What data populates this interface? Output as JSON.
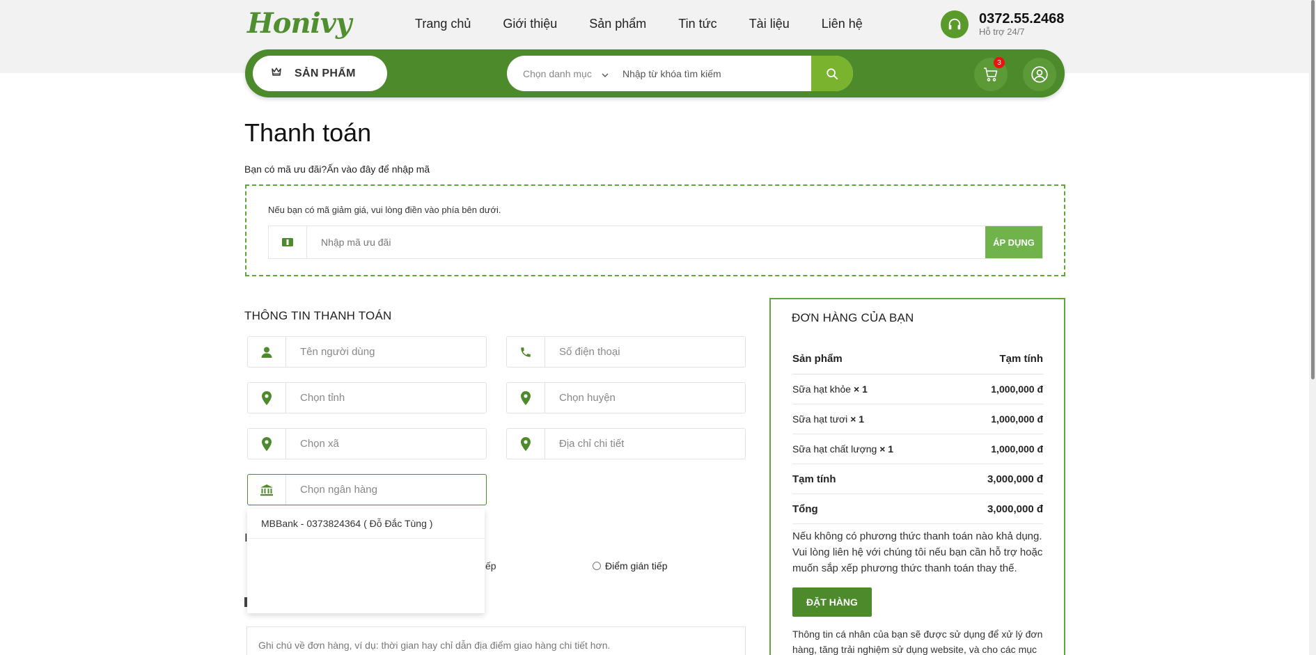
{
  "brand": {
    "logo_text": "Honivy"
  },
  "nav": {
    "items": [
      {
        "label": "Trang chủ"
      },
      {
        "label": "Giới thiệu"
      },
      {
        "label": "Sản phẩm"
      },
      {
        "label": "Tin tức"
      },
      {
        "label": "Tài liệu"
      },
      {
        "label": "Liên hệ"
      }
    ]
  },
  "hotline": {
    "number": "0372.55.2468",
    "sub": "Hỗ trợ 24/7",
    "icon": "headset-icon"
  },
  "toolbar": {
    "products_label": "SẢN PHẨM",
    "category_placeholder": "Chọn danh mục",
    "search_placeholder": "Nhập từ khóa tìm kiếm",
    "cart_count": "3"
  },
  "page": {
    "title": "Thanh toán",
    "coupon_prompt": "Bạn có mã ưu đãi?Ấn vào đây để nhập mã",
    "coupon_note": "Nếu bạn có mã giảm giá, vui lòng điền vào phía bên dưới.",
    "coupon_placeholder": "Nhập mã ưu đãi",
    "apply_label": "ÁP DỤNG"
  },
  "billing": {
    "title": "THÔNG TIN THANH TOÁN",
    "fields": {
      "name": "Tên người dùng",
      "phone": "Số điện thoại",
      "province": "Chọn tỉnh",
      "district": "Chọn huyện",
      "ward": "Chọn xã",
      "address": "Địa chỉ chi tiết",
      "bank": "Chọn ngân hàng"
    },
    "bank_options": [
      "MBBank - 0373824364 ( Đỗ Đắc Tùng )"
    ],
    "radio_partial": "ếp",
    "radio_indirect": "Điểm gián tiếp",
    "notes_placeholder": "Ghi chú về đơn hàng, ví dụ: thời gian hay chỉ dẫn địa điểm giao hàng chi tiết hơn."
  },
  "order": {
    "title": "ĐƠN HÀNG CỦA BẠN",
    "col_product": "Sản phẩm",
    "col_subtotal": "Tạm tính",
    "items": [
      {
        "name": "Sữa hạt khỏe",
        "qty": "× 1",
        "price": "1,000,000 đ"
      },
      {
        "name": "Sữa hạt tươi",
        "qty": "× 1",
        "price": "1,000,000 đ"
      },
      {
        "name": "Sữa hạt chất lượng",
        "qty": "× 1",
        "price": "1,000,000 đ"
      }
    ],
    "subtotal_label": "Tạm tính",
    "subtotal_value": "3,000,000 đ",
    "total_label": "Tổng",
    "total_value": "3,000,000 đ",
    "payment_note": "Nếu không có phương thức thanh toán nào khả dụng. Vui lòng liên hệ với chúng tôi nếu bạn cần hỗ trợ hoặc muốn sắp xếp phương thức thanh toán thay thế.",
    "place_order": "ĐẶT HÀNG",
    "privacy": "Thông tin cá nhân của bạn sẽ được sử dụng để xử lý đơn hàng, tăng trải nghiệm sử dụng website, và cho các mục"
  },
  "colors": {
    "primary": "#4c8a2b",
    "accent": "#7ab42f",
    "badge": "#e11111"
  }
}
